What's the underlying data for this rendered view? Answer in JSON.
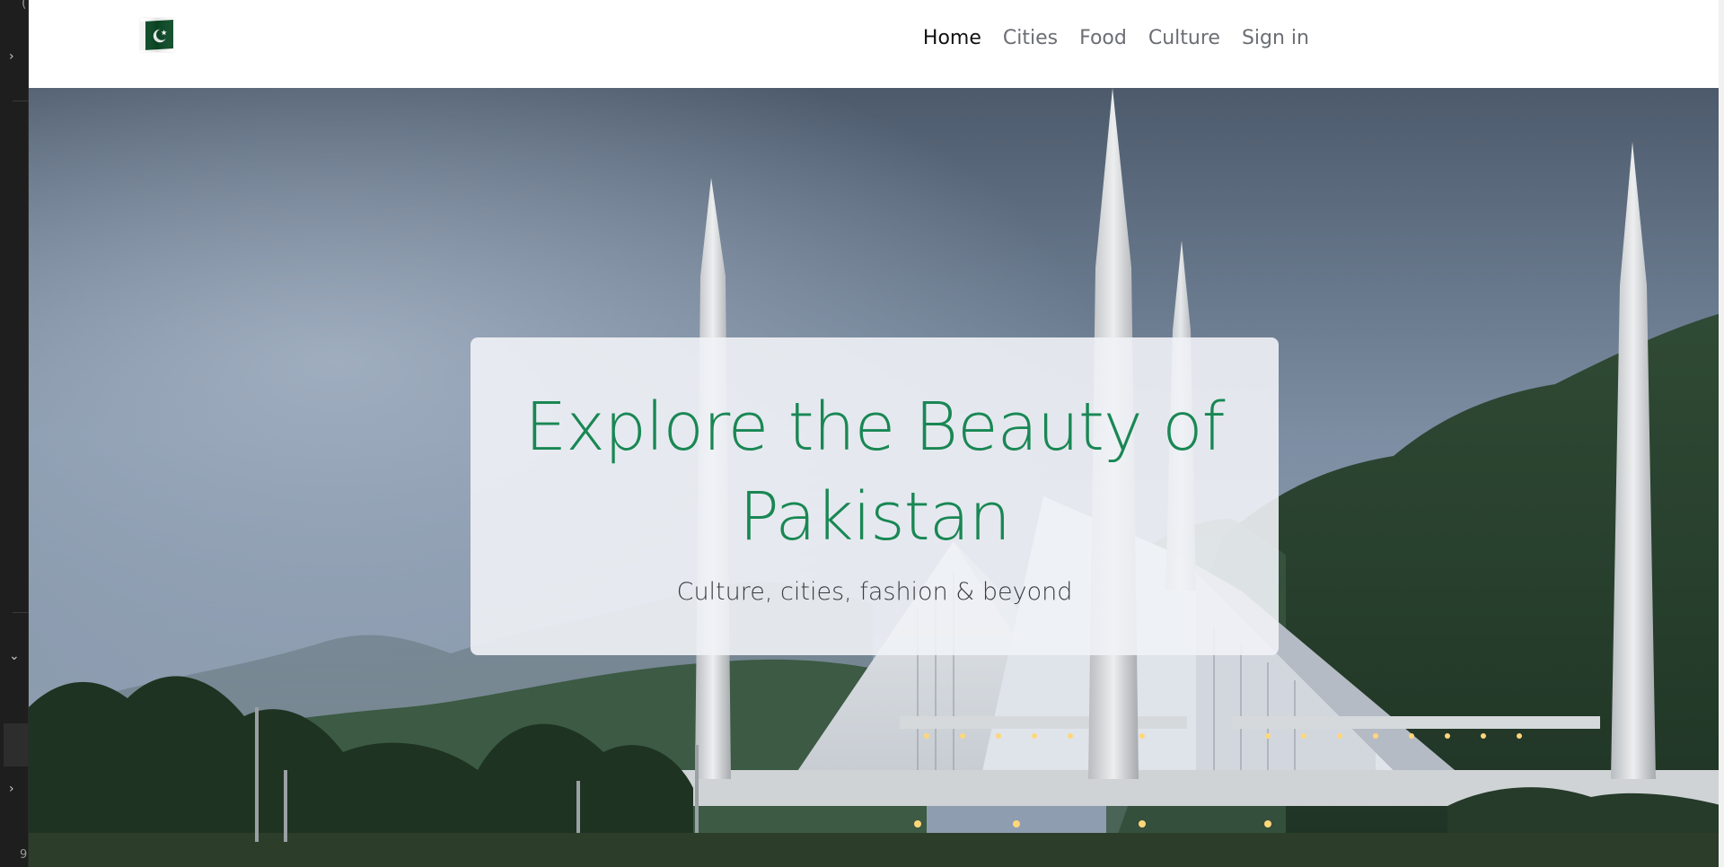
{
  "app": {
    "left_panel_digit": "9"
  },
  "navbar": {
    "logo_icon": "pakistan-flag-icon",
    "links": [
      {
        "label": "Home",
        "active": true
      },
      {
        "label": "Cities",
        "active": false
      },
      {
        "label": "Food",
        "active": false
      },
      {
        "label": "Culture",
        "active": false
      },
      {
        "label": "Sign in",
        "active": false
      }
    ]
  },
  "hero": {
    "title": "Explore the Beauty of Pakistan",
    "subtitle": "Culture, cities, fashion & beyond",
    "background": "faisal-mosque-photo",
    "title_color": "#198754"
  },
  "colors": {
    "accent": "#198754",
    "flag_green": "#01411C",
    "nav_text": "#6b6e73",
    "nav_active": "#111111"
  }
}
